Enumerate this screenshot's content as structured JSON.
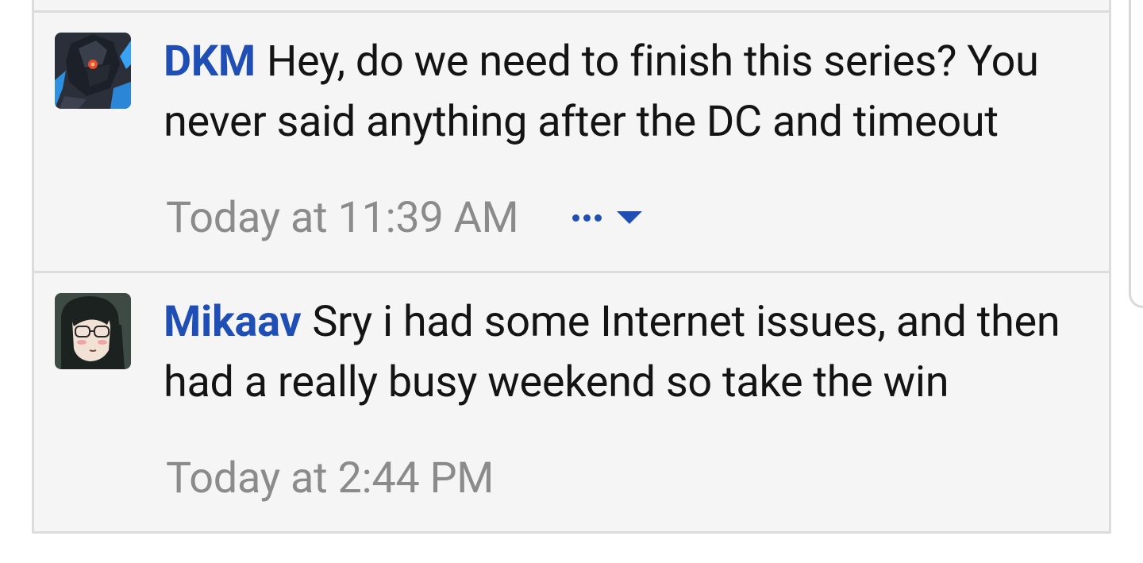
{
  "messages": [
    {
      "username": "DKM",
      "text": "Hey, do we need to finish this series? You never said anything after the DC and timeout",
      "timestamp": "Today at 11:39 AM",
      "avatar_icon": "dark-anime-character-avatar",
      "has_more_menu": true
    },
    {
      "username": "Mikaav",
      "text": "Sry i had some Internet issues, and then had a really busy weekend so take the win",
      "timestamp": "Today at 2:44 PM",
      "avatar_icon": "anime-girl-glasses-avatar",
      "has_more_menu": false
    }
  ],
  "colors": {
    "username": "#1f4fb5",
    "message_text": "#141414",
    "timestamp": "#8b8b8b",
    "background": "#f5f5f5",
    "divider": "#dcdcdc"
  }
}
